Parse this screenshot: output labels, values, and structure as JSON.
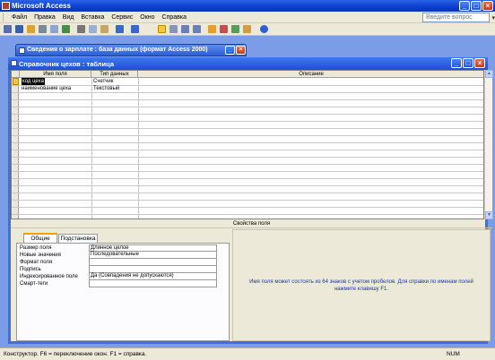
{
  "app": {
    "title": "Microsoft Access"
  },
  "menu": {
    "items": [
      "Файл",
      "Правка",
      "Вид",
      "Вставка",
      "Сервис",
      "Окно",
      "Справка"
    ],
    "help_placeholder": "Введите вопрос"
  },
  "db_tab": {
    "title": "Сведения о зарплате : база данных (формат Access 2000)"
  },
  "table_window": {
    "title": "Справочник цехов : таблица"
  },
  "grid": {
    "columns": [
      "Имя поля",
      "Тип данных",
      "Описание"
    ],
    "rows": [
      {
        "name": "код цеха",
        "type": "Счетчик",
        "description": ""
      },
      {
        "name": "наименование цеха",
        "type": "Текстовый",
        "description": ""
      }
    ]
  },
  "properties": {
    "header": "Свойства поля",
    "tabs": [
      "Общие",
      "Подстановка"
    ],
    "active_tab": "Общие",
    "fields": [
      {
        "label": "Размер поля",
        "value": "Длинное целое"
      },
      {
        "label": "Новые значения",
        "value": "Последовательные"
      },
      {
        "label": "Формат поля",
        "value": ""
      },
      {
        "label": "Подпись",
        "value": ""
      },
      {
        "label": "Индексированное поле",
        "value": "Да (Совпадения не допускаются)"
      },
      {
        "label": "Смарт-теги",
        "value": ""
      }
    ],
    "hint": "Имя поля может состоять из 64 знаков с учетом пробелов.  Для справки по именам полей нажмите клавишу F1."
  },
  "status": {
    "left": "Конструктор.  F6 = переключение окон.  F1 = справка.",
    "right": "NUM"
  },
  "colors": {
    "titlebar": "#0a3fd0",
    "desktop": "#7b9de7",
    "chrome": "#ece9d8",
    "hint_text": "#1d37a8"
  }
}
